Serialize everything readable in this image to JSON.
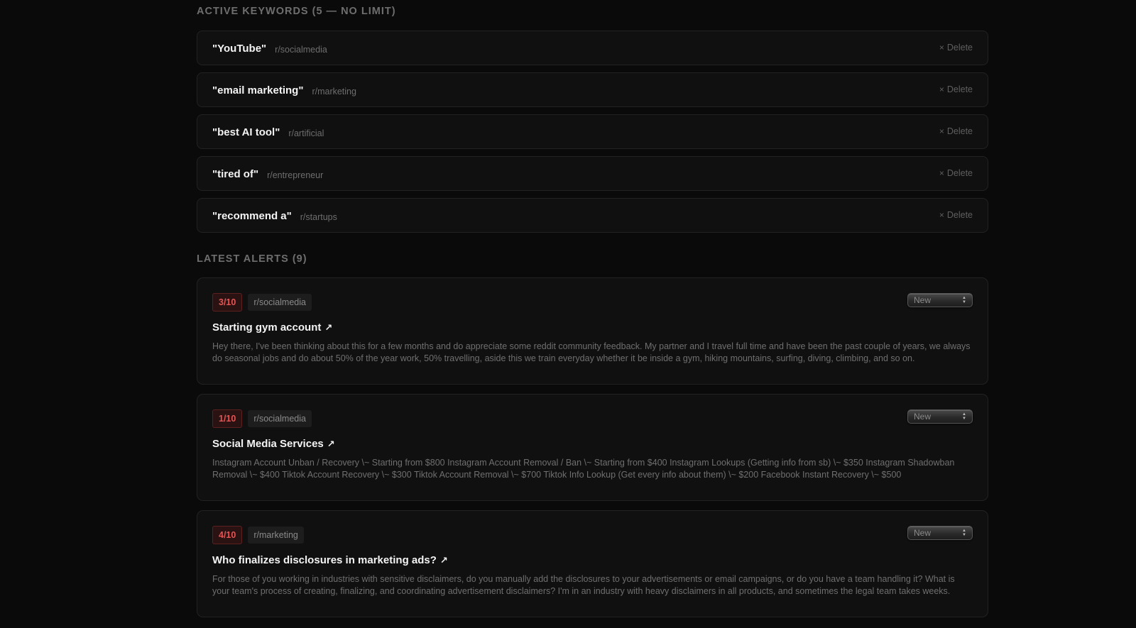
{
  "keywords": {
    "title": "ACTIVE KEYWORDS (5 — NO LIMIT)",
    "delete_label": "Delete",
    "items": [
      {
        "term": "\"YouTube\"",
        "subreddit": "r/socialmedia"
      },
      {
        "term": "\"email marketing\"",
        "subreddit": "r/marketing"
      },
      {
        "term": "\"best AI tool\"",
        "subreddit": "r/artificial"
      },
      {
        "term": "\"tired of\"",
        "subreddit": "r/entrepreneur"
      },
      {
        "term": "\"recommend a\"",
        "subreddit": "r/startups"
      }
    ]
  },
  "alerts": {
    "title": "LATEST ALERTS (9)",
    "items": [
      {
        "score": "3/10",
        "subreddit": "r/socialmedia",
        "status": "New",
        "title": "Starting gym account",
        "body": "Hey there, I've been thinking about this for a few months and do appreciate some reddit community feedback. My partner and I travel full time and have been the past couple of years, we always do seasonal jobs and do about 50% of the year work, 50% travelling, aside this we train everyday whether it be inside a gym, hiking mountains, surfing, diving, climbing, and so on."
      },
      {
        "score": "1/10",
        "subreddit": "r/socialmedia",
        "status": "New",
        "title": "Social Media Services",
        "body": "Instagram Account Unban / Recovery \\~ Starting from $800 Instagram Account Removal / Ban \\~ Starting from $400 Instagram Lookups (Getting info from sb) \\~ $350 Instagram Shadowban Removal \\~ $400 Tiktok Account Recovery \\~ $300 Tiktok Account Removal \\~ $700 Tiktok Info Lookup (Get every info about them) \\~ $200 Facebook Instant Recovery \\~ $500"
      },
      {
        "score": "4/10",
        "subreddit": "r/marketing",
        "status": "New",
        "title": "Who finalizes disclosures in marketing ads?",
        "body": "For those of you working in industries with sensitive disclaimers, do you manually add the disclosures to your advertisements or email campaigns, or do you have a team handling it? What is your team's process of creating, finalizing, and coordinating advertisement disclaimers? I'm in an industry with heavy disclaimers in all products, and sometimes the legal team takes weeks."
      }
    ]
  },
  "icons": {
    "delete": "close-icon",
    "external": "external-link-icon",
    "select": "chevron-updown-icon"
  },
  "colors": {
    "background": "#0a0a0a",
    "card": "#101010",
    "score_text": "#e35555",
    "score_bg": "#2a1212"
  }
}
